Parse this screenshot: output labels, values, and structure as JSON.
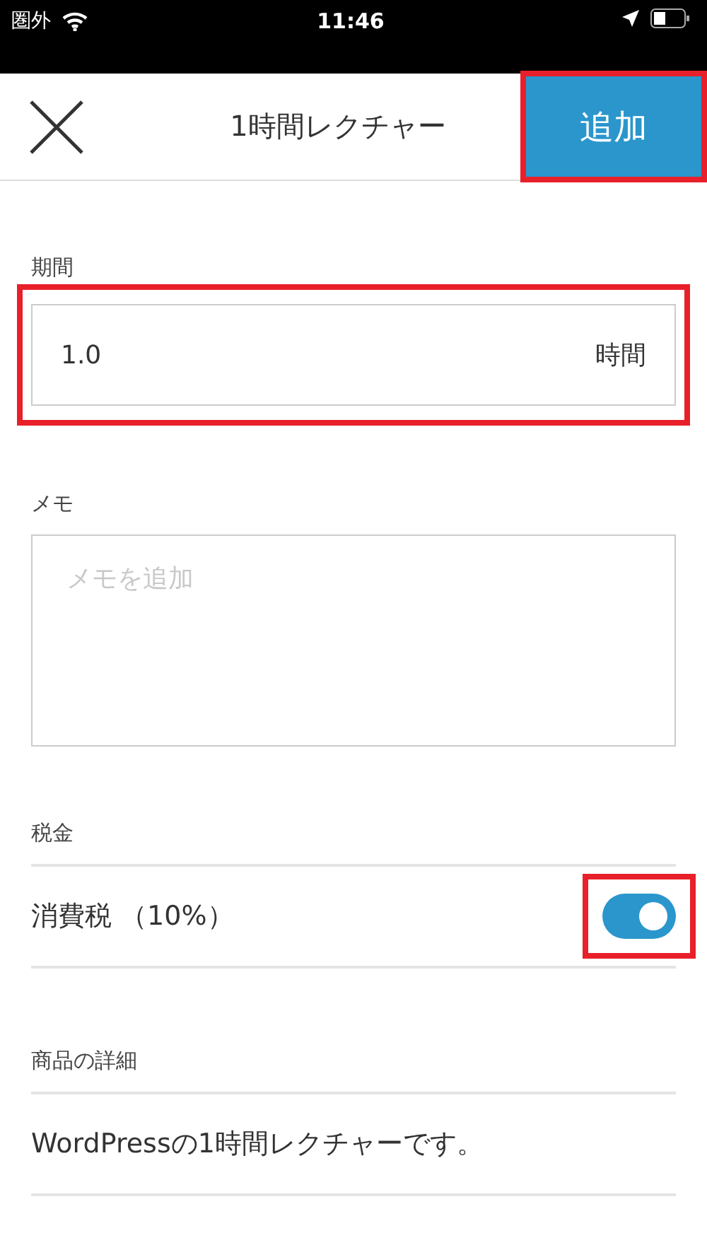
{
  "status_bar": {
    "carrier": "圏外",
    "time": "11:46"
  },
  "header": {
    "title": "1時間レクチャー",
    "add_button": {
      "label": "追加",
      "highlighted": true
    }
  },
  "duration": {
    "label": "期間",
    "value": "1.0",
    "unit": "時間",
    "highlighted": true
  },
  "memo": {
    "label": "メモ",
    "placeholder": "メモを追加"
  },
  "tax": {
    "label": "税金",
    "items": [
      {
        "name": "消費税 （10%）",
        "on": true,
        "highlighted": true
      }
    ]
  },
  "details": {
    "label": "商品の詳細",
    "text": "WordPressの1時間レクチャーです。"
  }
}
